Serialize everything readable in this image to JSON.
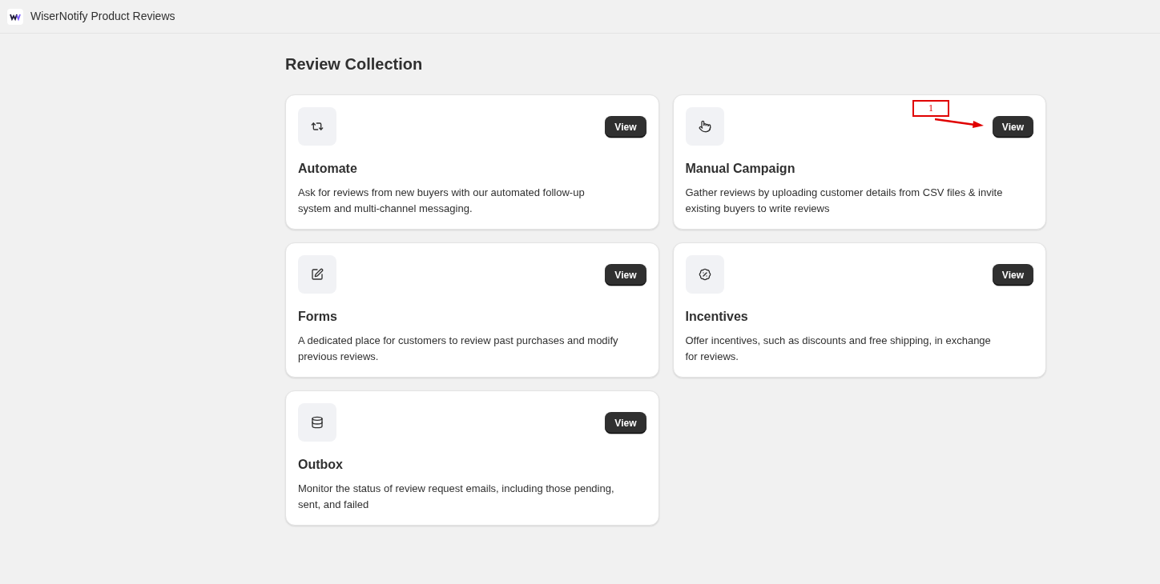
{
  "app_bar": {
    "title": "WiserNotify Product Reviews"
  },
  "page_title": "Review Collection",
  "annotation": {
    "label": "1"
  },
  "cards": [
    {
      "kind": "repeat",
      "title": "Automate",
      "description": "Ask for reviews from new buyers with our automated follow-up system and multi-channel messaging.",
      "button": "View"
    },
    {
      "kind": "pointer",
      "title": "Manual Campaign",
      "description": "Gather reviews by uploading customer details from CSV files & invite existing buyers to write reviews",
      "button": "View"
    },
    {
      "kind": "edit",
      "title": "Forms",
      "description": "A dedicated place for customers to review past purchases and modify previous reviews.",
      "button": "View"
    },
    {
      "kind": "percent",
      "title": "Incentives",
      "description": "Offer incentives, such as discounts and free shipping, in exchange for reviews.",
      "button": "View"
    },
    {
      "kind": "database",
      "title": "Outbox",
      "description": "Monitor the status of review request emails, including those pending, sent, and failed",
      "button": "View"
    }
  ]
}
